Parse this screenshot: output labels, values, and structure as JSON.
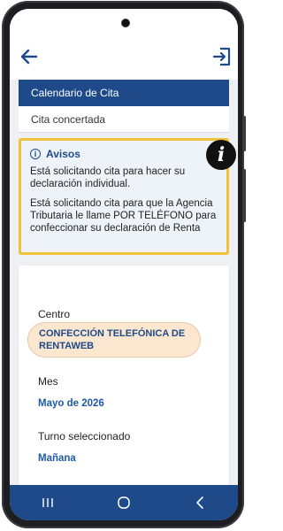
{
  "header": {
    "back_icon": "arrow-left-icon",
    "exit_icon": "logout-icon"
  },
  "tabs": {
    "active_label": "Calendario de Cita",
    "inactive_label": "Cita concertada"
  },
  "notice": {
    "title": "Avisos",
    "paragraph1": "Está solicitando cita para hacer su declaración individual.",
    "paragraph2": "Está solicitando cita para que la Agencia Tributaria le llame POR TELÉFONO para confeccionar su declaración de Renta"
  },
  "form": {
    "centro_label": "Centro",
    "centro_value_line1": "CONFECCIÓN TELEFÓNICA DE",
    "centro_value_line2": "RENTAWEB",
    "mes_label": "Mes",
    "mes_value": "Mayo de 2026",
    "turno_label": "Turno seleccionado",
    "turno_value": "Mañana"
  },
  "colors": {
    "primary": "#1e4a8a",
    "notice_border": "#f0c23a",
    "chip_bg": "#fbe6cf"
  }
}
